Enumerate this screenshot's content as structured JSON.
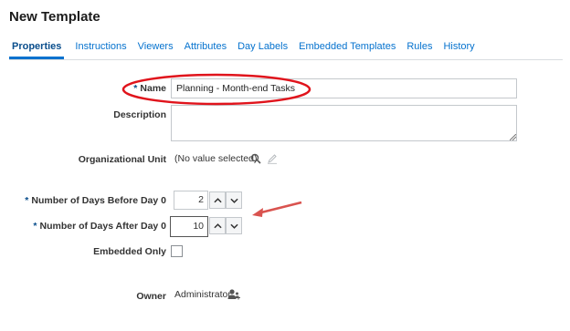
{
  "page": {
    "title": "New Template"
  },
  "tabs": [
    {
      "label": "Properties"
    },
    {
      "label": "Instructions"
    },
    {
      "label": "Viewers"
    },
    {
      "label": "Attributes"
    },
    {
      "label": "Day Labels"
    },
    {
      "label": "Embedded Templates"
    },
    {
      "label": "Rules"
    },
    {
      "label": "History"
    }
  ],
  "form": {
    "required_marker": "*",
    "name": {
      "label": "Name",
      "value": "Planning - Month-end Tasks"
    },
    "description": {
      "label": "Description",
      "value": ""
    },
    "org_unit": {
      "label": "Organizational Unit",
      "value": "(No value selected)",
      "search_icon": "search-icon",
      "edit_icon": "pencil-icon"
    },
    "days_before": {
      "label": "Number of Days Before Day 0",
      "value": "2"
    },
    "days_after": {
      "label": "Number of Days After Day 0",
      "value": "10"
    },
    "embedded_only": {
      "label": "Embedded Only",
      "checked": false
    },
    "owner": {
      "label": "Owner",
      "value": "Administrator",
      "icon": "select-user-icon"
    }
  },
  "annotations": {
    "highlight_color": "#e0141c",
    "arrow_color": "#d9534f"
  }
}
